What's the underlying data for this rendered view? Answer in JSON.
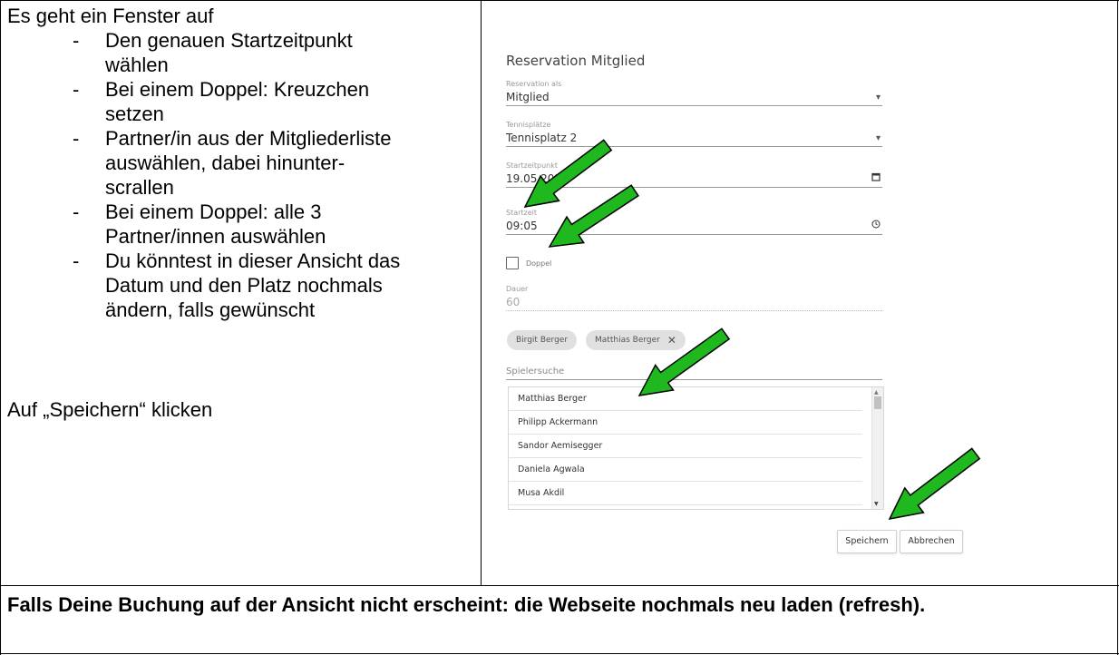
{
  "left": {
    "intro": "Es geht ein Fenster auf",
    "bullet_marker": "-",
    "bullets": [
      [
        "Den genauen Startzeitpunkt",
        "wählen"
      ],
      [
        "Bei einem Doppel: Kreuzchen",
        "setzen"
      ],
      [
        "Partner/in aus der Mitgliederliste",
        "auswählen, dabei hinunter-",
        "scrallen"
      ],
      [
        "Bei einem Doppel: alle 3",
        "Partner/innen auswählen"
      ],
      [
        "Du könntest in dieser Ansicht das",
        "Datum und den Platz nochmals",
        "ändern, falls gewünscht"
      ]
    ],
    "save_note": "Auf „Speichern“ klicken"
  },
  "bottom_note": "Falls Deine Buchung auf der Ansicht nicht erscheint: die Webseite nochmals neu laden (refresh).",
  "app": {
    "title": "Reservation Mitglied",
    "fields": {
      "reservation_as": {
        "label": "Reservation als",
        "value": "Mitglied",
        "icon": "dropdown-arrow-icon"
      },
      "court": {
        "label": "Tennisplätze",
        "value": "Tennisplatz 2",
        "icon": "dropdown-arrow-icon"
      },
      "start_date": {
        "label": "Startzeitpunkt",
        "value": "19.05.2020",
        "icon": "calendar-icon"
      },
      "start_time": {
        "label": "Startzeit",
        "value": "09:05",
        "icon": "clock-icon"
      },
      "duration": {
        "label": "Dauer",
        "value": "60"
      }
    },
    "doubles_label": "Doppel",
    "doubles_checked": false,
    "chips": [
      {
        "label": "Birgit Berger",
        "removable": false
      },
      {
        "label": "Matthias Berger",
        "removable": true
      }
    ],
    "chip_remove_glyph": "✕",
    "search_placeholder": "Spielersuche",
    "players": [
      "Matthias Berger",
      "Philipp Ackermann",
      "Sandor Aemisegger",
      "Daniela Agwala",
      "Musa Akdil"
    ],
    "buttons": {
      "save": "Speichern",
      "cancel": "Abbrechen"
    }
  },
  "colors": {
    "arrow_fill": "#1fb81f",
    "arrow_stroke": "#000000",
    "border": "#000000"
  }
}
